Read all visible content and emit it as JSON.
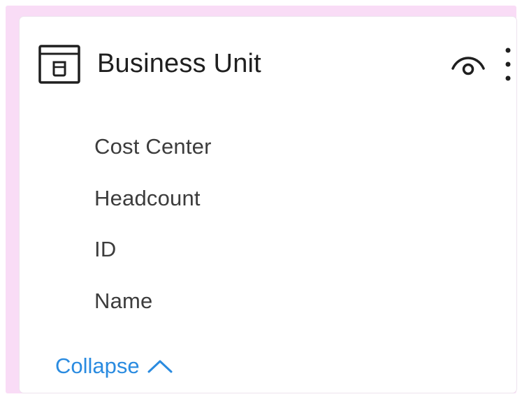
{
  "card": {
    "title": "Business Unit",
    "icons": {
      "table": "table-icon",
      "visibility": "eye-icon",
      "more": "more-vertical-icon",
      "collapse": "chevron-up-icon"
    },
    "fields": [
      {
        "label": "Cost Center"
      },
      {
        "label": "Headcount"
      },
      {
        "label": "ID"
      },
      {
        "label": "Name"
      }
    ],
    "collapse_label": "Collapse"
  },
  "colors": {
    "frame": "#f9dcf6",
    "card": "#ffffff",
    "text": "#1f1f1f",
    "field_text": "#3c3c3c",
    "link": "#2a8be0"
  }
}
